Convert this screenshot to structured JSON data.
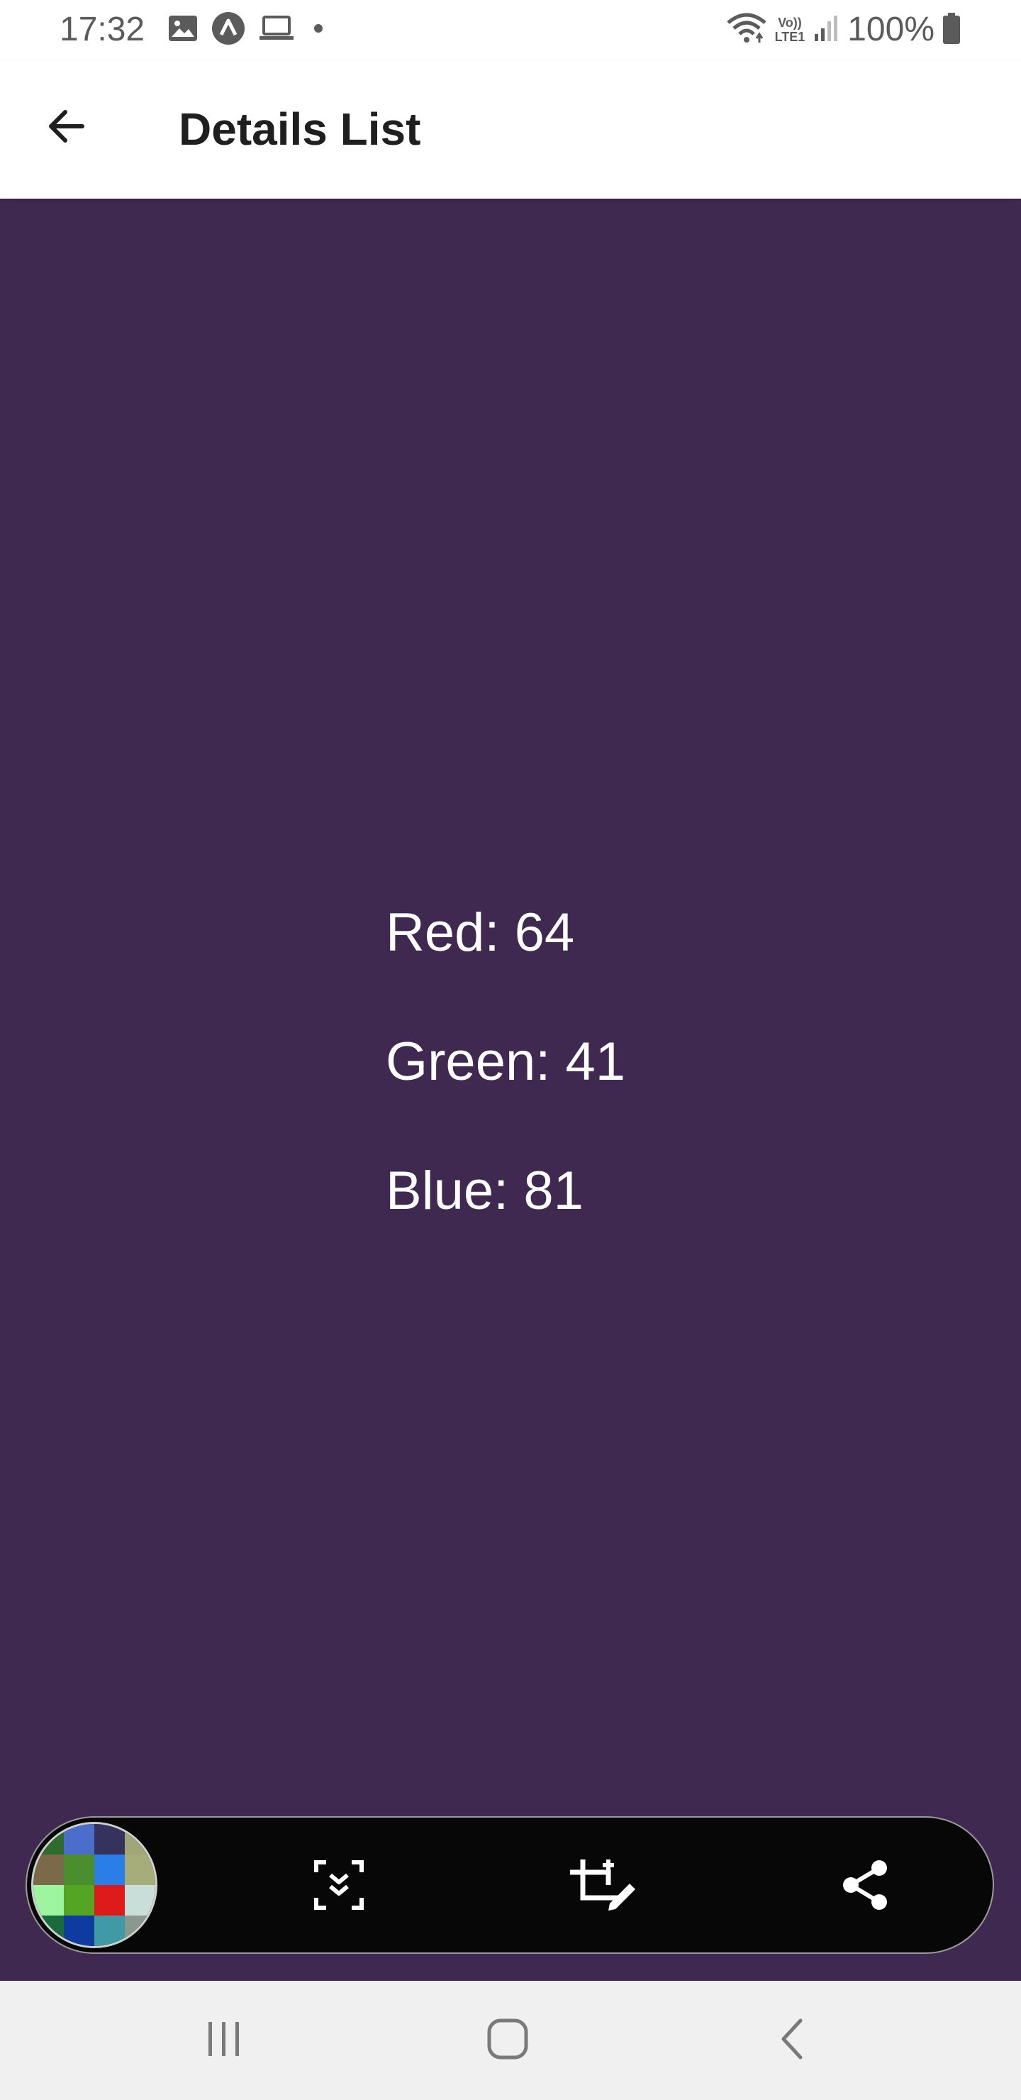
{
  "status_bar": {
    "time": "17:32",
    "battery": "100%",
    "left_icons": [
      "image-icon",
      "arrow-up-circle-icon",
      "laptop-icon",
      "dot-icon"
    ],
    "right_icons": [
      "wifi-icon",
      "volte-icon",
      "signal-icon",
      "battery-icon"
    ],
    "volte_label": "Vo))",
    "lte_label": "LTE1"
  },
  "app_bar": {
    "title": "Details List",
    "back_icon": "arrow-left-icon"
  },
  "content": {
    "background": "#3f2951",
    "lines": [
      {
        "label": "Red: 64"
      },
      {
        "label": "Green: 41"
      },
      {
        "label": "Blue: 81"
      }
    ]
  },
  "toolbar": {
    "thumbnail_colors": [
      "#2f6b2a",
      "#4a6ec9",
      "#35325e",
      "#a0a67a",
      "#7a6a49",
      "#4b8e2d",
      "#2b7de8",
      "#a7ad7a",
      "#9ef5a0",
      "#53a523",
      "#de1b1b",
      "#c9ddd9",
      "#1b6a3b",
      "#0e3ba0",
      "#3f9aa6",
      "#8b9890"
    ],
    "buttons": [
      "scroll-capture-icon",
      "crop-edit-icon",
      "share-icon"
    ]
  },
  "nav_bar": {
    "buttons": [
      "recent-apps-icon",
      "home-icon",
      "back-icon"
    ]
  }
}
